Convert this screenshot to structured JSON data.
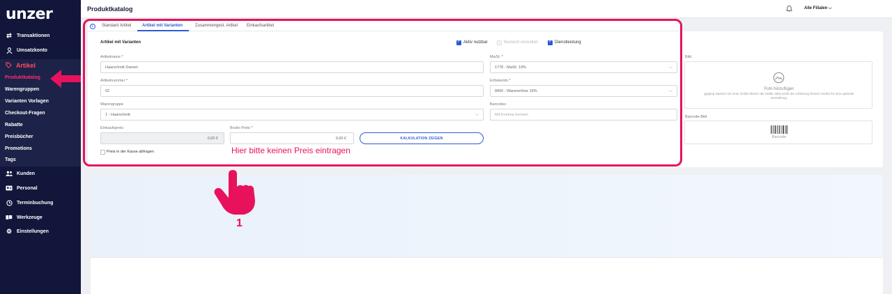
{
  "brand": {
    "logo": "unzer"
  },
  "sidebar": {
    "items": [
      {
        "label": "Transaktionen",
        "icon": "transactions-icon"
      },
      {
        "label": "Umsatzkonto",
        "icon": "user-icon"
      },
      {
        "label": "Artikel",
        "icon": "tag-icon"
      },
      {
        "label": "Kunden",
        "icon": "customers-icon"
      },
      {
        "label": "Personal",
        "icon": "id-card-icon"
      },
      {
        "label": "Terminbuchung",
        "icon": "clock-icon"
      },
      {
        "label": "Werkzeuge",
        "icon": "tools-icon"
      },
      {
        "label": "Einstellungen",
        "icon": "gear-icon"
      }
    ],
    "artikel_sub": [
      "Produktkatalog",
      "Warengruppen",
      "Varianten Vorlagen",
      "Checkout-Fragen",
      "Rabatte",
      "Preisbücher",
      "Promotions",
      "Tags"
    ]
  },
  "header": {
    "title": "Produktkatalog",
    "branch": "Alle Filialen ⌵"
  },
  "tabs": [
    "Standard Artikel",
    "Artikel mit Varianten",
    "Zusammengest. Artikel",
    "Einkaufsartikel"
  ],
  "form": {
    "section_title": "Artikel mit Varianten",
    "checks": {
      "aktiv": "Aktiv nutzbar",
      "bestand": "Bestand verwalten",
      "dienst": "Dienstleistung"
    },
    "artikelname_label": "Artikelname *",
    "artikelname_value": "Haarschnitt Damen",
    "mwst_label": "MwSt. *",
    "mwst_value": "1778 - MwSt. 19%",
    "artikelnummer_label": "Artikelnummer *",
    "artikelnummer_value": "02",
    "erloes_label": "Erlöskonto *",
    "erloes_value": "8400 - Warenerlöse 19%",
    "warengruppe_label": "Warengruppe",
    "warengruppe_value": "1 - Haarschnitt",
    "barcodes_label": "Barcodes",
    "barcodes_placeholder": "Mit Komma trennen",
    "einkauf_label": "Einkaufspreis",
    "einkauf_value": "0,00 €",
    "brutto_label": "Brutto Preis *",
    "brutto_value": "0,00 €",
    "kalk_button": "KALKULATION ZEIGEN",
    "kasse_label": "Preis in der Kasse abfragen"
  },
  "media": {
    "bild_label": "Bild",
    "bild_title": "Foto hinzufügen",
    "bild_hint": "jpg/png Dateien mit einer Größe kleiner als 100kb. Bitte prüfe die Auflösung Deines Geräts für eine optimale Darstellung.",
    "barcode_label": "Barcode-Bild",
    "barcode_text": "Barcode"
  },
  "annotation": {
    "text": "Hier bitte keinen Preis eintragen",
    "step": "1"
  },
  "colors": {
    "accent": "#e8125c",
    "primary": "#2a5bd7",
    "sidebar": "#11163a"
  }
}
